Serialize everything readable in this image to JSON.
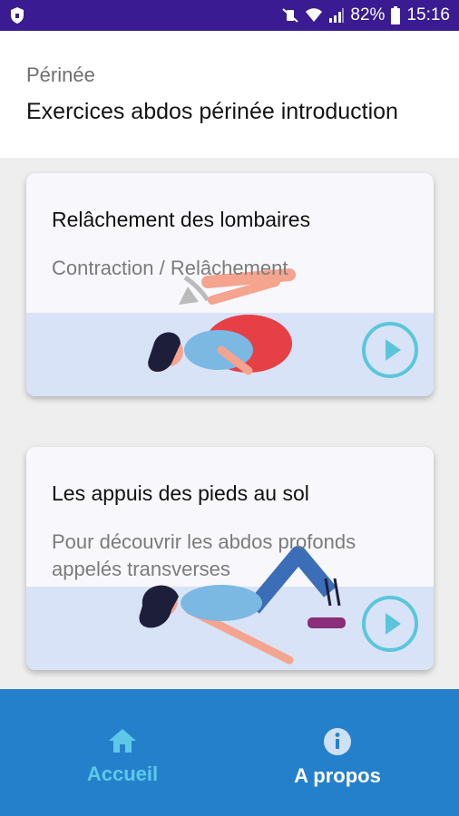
{
  "status_bar": {
    "battery": "82%",
    "time": "15:16"
  },
  "header": {
    "overline": "Périnée",
    "title": "Exercices abdos périnée introduction"
  },
  "cards": [
    {
      "title": "Relâchement des lombaires",
      "subtitle": "Contraction / Relâchement",
      "play_icon": "play-circle-icon"
    },
    {
      "title": "Les appuis des pieds au sol",
      "subtitle": "Pour découvrir les abdos profonds appelés transverses",
      "play_icon": "play-circle-icon"
    }
  ],
  "bottom_nav": {
    "home_label": "Accueil",
    "about_label": "A propos",
    "active": "home",
    "active_color": "#5fc8e8"
  },
  "colors": {
    "status_bar": "#3b1b91",
    "nav_bar": "#2580cc",
    "accent": "#5bc6db"
  }
}
